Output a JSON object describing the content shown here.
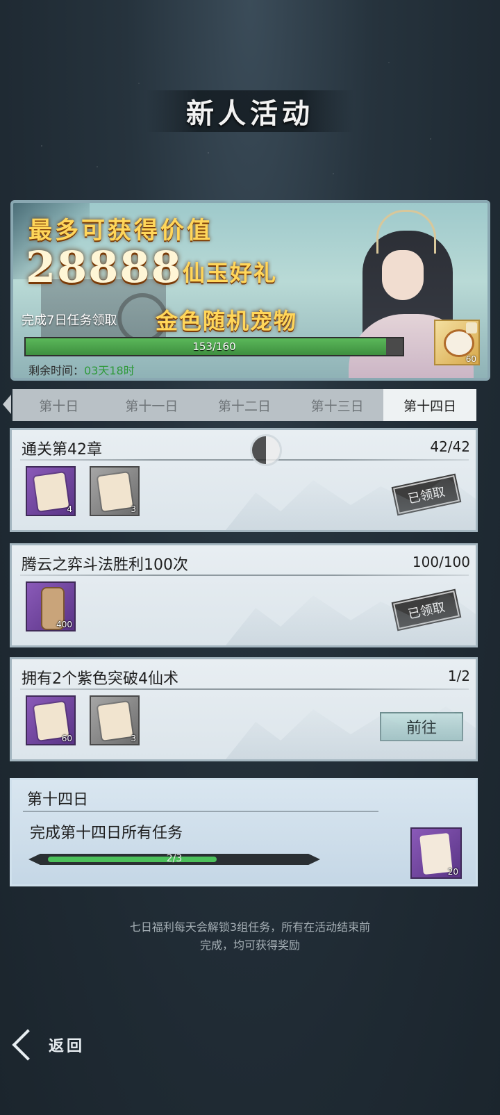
{
  "header": {
    "title": "新人活动"
  },
  "banner": {
    "headline": "最多可获得价值",
    "value": "28888",
    "gift": "仙玉好礼",
    "condition": "完成7日任务领取",
    "reward": "金色随机宠物",
    "progress": {
      "current": 153,
      "max": 160,
      "label": "153/160",
      "fraction": 0.956
    },
    "time_label": "剩余时间：",
    "time_value": "03天18时",
    "reward_item": {
      "icon": "pet-egg-icon",
      "count": "60"
    }
  },
  "tabs": [
    "第十日",
    "第十一日",
    "第十二日",
    "第十三日",
    "第十四日"
  ],
  "active_tab": "第十四日",
  "tasks": [
    {
      "title": "通关第42章",
      "count": "42/42",
      "items": [
        {
          "icon": "scroll-chart-icon",
          "rarity": "purple",
          "count": "4"
        },
        {
          "icon": "paper-icon",
          "rarity": "grey",
          "count": "3"
        }
      ],
      "status": "已领取"
    },
    {
      "title": "腾云之弈斗法胜利100次",
      "count": "100/100",
      "items": [
        {
          "icon": "scroll-icon",
          "rarity": "purple",
          "count": "400"
        }
      ],
      "status": "已领取"
    },
    {
      "title": "拥有2个紫色突破4仙术",
      "count": "1/2",
      "items": [
        {
          "icon": "map-fragment-icon",
          "rarity": "purple",
          "count": "60"
        },
        {
          "icon": "paper-icon",
          "rarity": "grey",
          "count": "3"
        }
      ],
      "button": "前往"
    }
  ],
  "day_summary": {
    "title": "第十四日",
    "desc": "完成第十四日所有任务",
    "progress_label": "2/3",
    "progress_fraction": 0.667,
    "reward": {
      "icon": "paw-scroll-icon",
      "count": "20"
    }
  },
  "footer": {
    "line1": "七日福利每天会解锁3组任务，所有在活动结束前",
    "line2": "完成，均可获得奖励"
  },
  "back": {
    "label": "返回"
  }
}
